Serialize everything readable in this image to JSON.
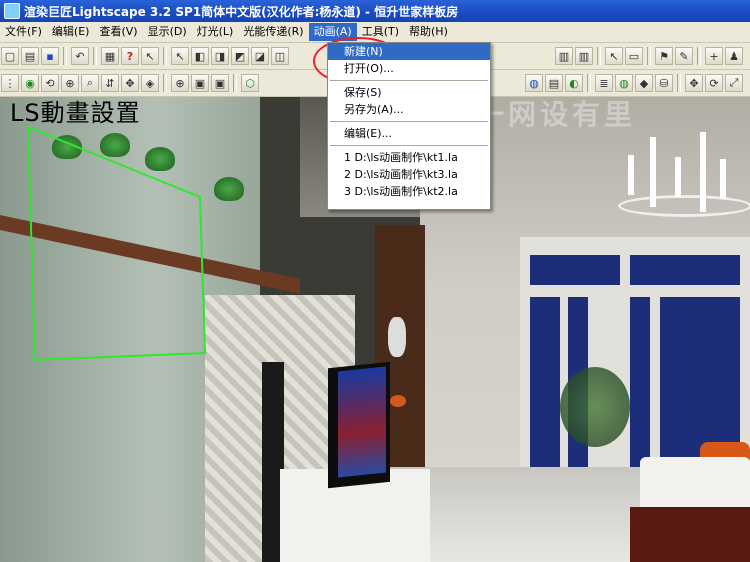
{
  "window": {
    "title": "渲染巨匠Lightscape 3.2 SP1简体中文版(汉化作者:杨永道) - 恒升世家样板房"
  },
  "menubar": {
    "items": [
      {
        "label": "文件(F)"
      },
      {
        "label": "编辑(E)"
      },
      {
        "label": "查看(V)"
      },
      {
        "label": "显示(D)"
      },
      {
        "label": "灯光(L)"
      },
      {
        "label": "光能传递(R)"
      },
      {
        "label": "动画(A)"
      },
      {
        "label": "工具(T)"
      },
      {
        "label": "帮助(H)"
      }
    ],
    "active_index": 6
  },
  "dropdown": {
    "items": [
      {
        "label": "新建(N)"
      },
      {
        "label": "打开(O)..."
      },
      {
        "label": "保存(S)"
      },
      {
        "label": "另存为(A)..."
      },
      {
        "label": "编辑(E)..."
      },
      {
        "label": "1 D:\\ls动画制作\\kt1.la"
      },
      {
        "label": "2 D:\\ls动画制作\\kt3.la"
      },
      {
        "label": "3 D:\\ls动画制作\\kt2.la"
      }
    ],
    "highlight_index": 0
  },
  "viewport": {
    "overlay_title": "LS動畫設置",
    "watermark": "一网一网设有里"
  },
  "colors": {
    "titlebar": "#1a4bc0",
    "menu_highlight": "#316ac5",
    "selection_box": "#2ee82e",
    "annotation_circle": "#e8202a"
  }
}
